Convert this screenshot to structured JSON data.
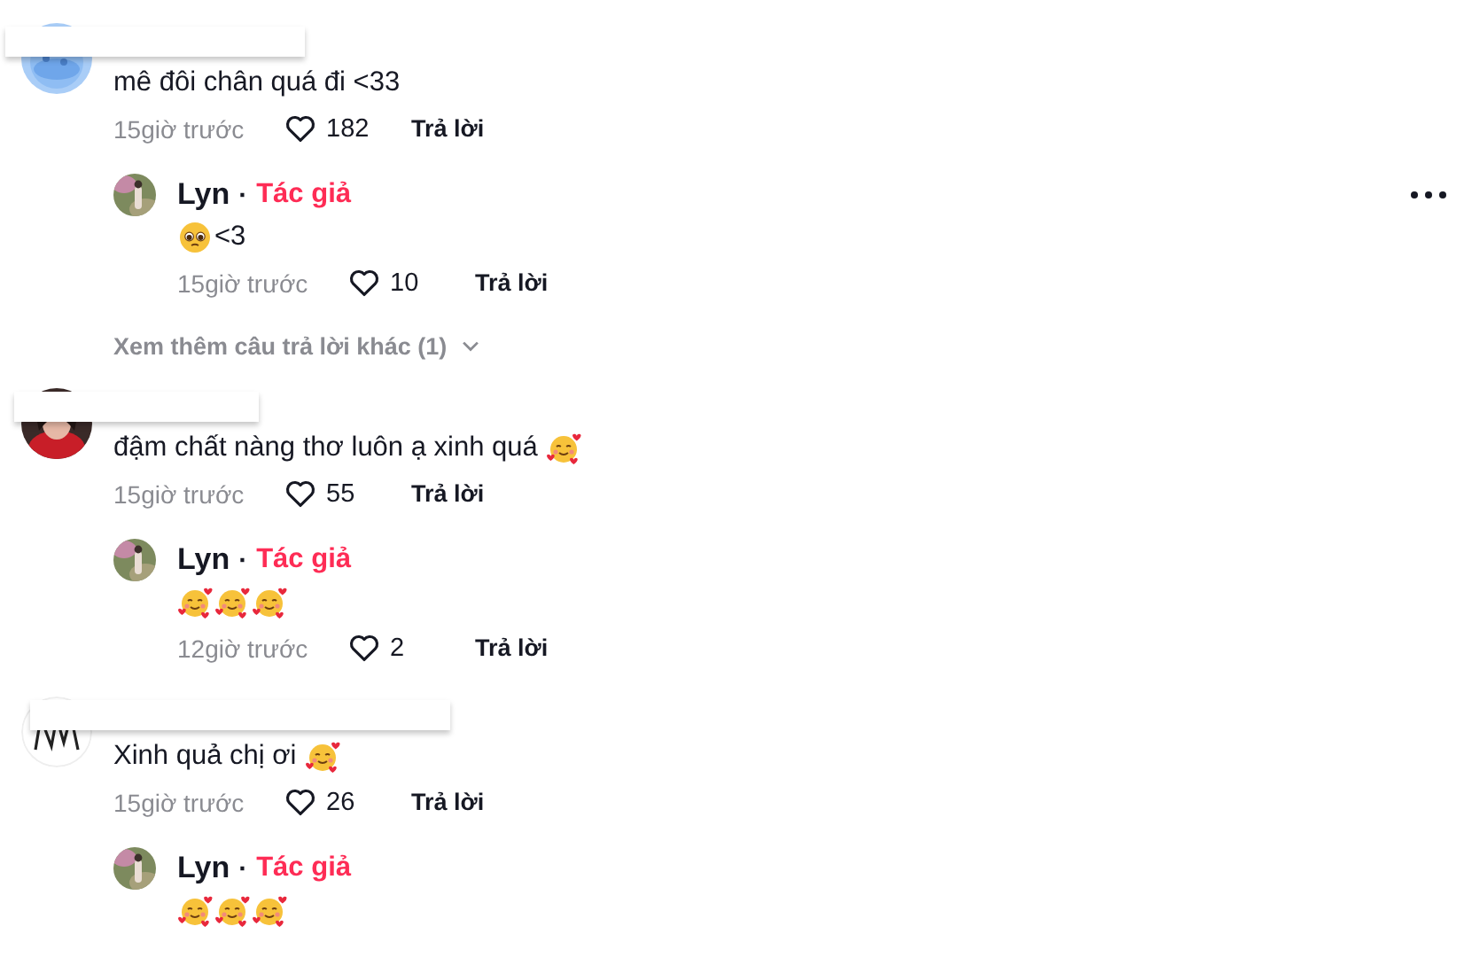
{
  "comments": [
    {
      "body": [
        {
          "kind": "text",
          "text": "mê đôi chân quá đi <33"
        }
      ],
      "time": "15giờ trước",
      "likes": "182",
      "reply_label": "Trả lời",
      "replies": [
        {
          "author": "Lyn",
          "separator": "·",
          "badge": "Tác giả",
          "body": [
            {
              "kind": "pleading-emoji"
            },
            {
              "kind": "text",
              "text": "<3"
            }
          ],
          "time": "15giờ trước",
          "likes": "10",
          "reply_label": "Trả lời",
          "show_menu": true
        }
      ],
      "more_replies": "Xem thêm câu trả lời khác (1)"
    },
    {
      "body": [
        {
          "kind": "text",
          "text": "đậm chất nàng thơ luôn ạ xinh quá"
        },
        {
          "kind": "hearts-emoji"
        }
      ],
      "time": "15giờ trước",
      "likes": "55",
      "reply_label": "Trả lời",
      "replies": [
        {
          "author": "Lyn",
          "separator": "·",
          "badge": "Tác giả",
          "body": [
            {
              "kind": "hearts-emoji"
            },
            {
              "kind": "hearts-emoji"
            },
            {
              "kind": "hearts-emoji"
            }
          ],
          "time": "12giờ trước",
          "likes": "2",
          "reply_label": "Trả lời",
          "show_menu": false
        }
      ]
    },
    {
      "body": [
        {
          "kind": "text",
          "text": "Xinh quả chị ơi"
        },
        {
          "kind": "hearts-emoji"
        }
      ],
      "time": "15giờ trước",
      "likes": "26",
      "reply_label": "Trả lời",
      "replies": [
        {
          "author": "Lyn",
          "separator": "·",
          "badge": "Tác giả",
          "body": [
            {
              "kind": "hearts-emoji"
            },
            {
              "kind": "hearts-emoji"
            },
            {
              "kind": "hearts-emoji"
            }
          ],
          "show_menu": false
        }
      ]
    }
  ]
}
